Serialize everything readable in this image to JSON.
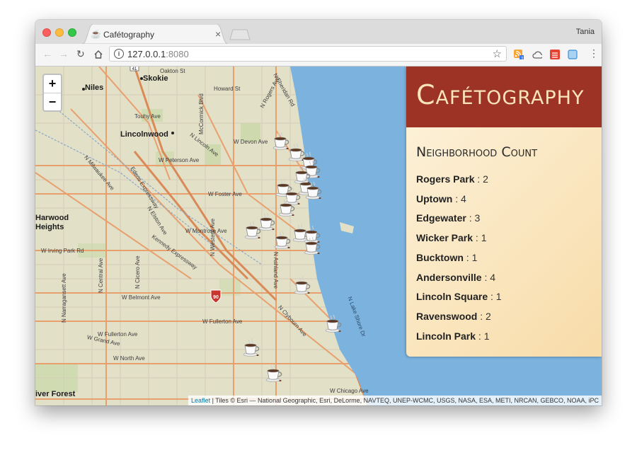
{
  "browser": {
    "tab_title": "Cafétography",
    "tab_icon": "coffee-cup-icon",
    "tab_close": "×",
    "user": "Tania",
    "url_host": "127.0.0.1",
    "url_port": ":8080"
  },
  "map": {
    "zoom_in": "+",
    "zoom_out": "−",
    "labels": {
      "niles": "Niles",
      "skokie": "Skokie",
      "lincolnwood": "Lincolnwood",
      "harwood": "Harwood",
      "heights": "Heights",
      "river_forest": "iver Forest",
      "oakton": "Oakton St",
      "howard": "Howard St",
      "touhy": "Touhy Ave",
      "devon": "W Devon Ave",
      "peterson": "W Peterson Ave",
      "foster": "W Foster Ave",
      "montrose": "W Montrose Ave",
      "irving": "W Irving Park Rd",
      "belmont": "W Belmont Ave",
      "fullerton": "W Fullerton Ave",
      "fullerton2": "W Fullerton Ave",
      "grand": "W Grand Ave",
      "north": "W North Ave",
      "chicago": "W Chicago Ave",
      "western": "N Western Ave",
      "cicero": "N Cicero Ave",
      "central": "N Central Ave",
      "narragansett": "N Narragansett Ave",
      "mccormick": "McCormick Blvd",
      "lincoln": "N Lincoln Ave",
      "elston": "N Elston Ave",
      "kennedy": "Kennedy Expressway",
      "edens": "Edens Expressway",
      "milwaukee": "N Milwaukee Ave",
      "clybourn": "N Clybourn Ave",
      "lakeshore": "N Lake Shore Dr",
      "rogers": "N Rogers Ave",
      "sheridan": "N Sheridan Rd",
      "ashland": "N Ashland Ave",
      "i90": "90",
      "i41": "41"
    },
    "attribution_link": "Leaflet",
    "attribution_text": " | Tiles © Esri — National Geographic, Esri, DeLorme, NAVTEQ, UNEP-WCMC, USGS, NASA, ESA, METI, NRCAN, GEBCO, NOAA, iPC",
    "marker_icon": "coffee-cup-icon",
    "colors": {
      "land": "#e3e0c8",
      "water": "#7bb3de",
      "road_major": "#e8a06e",
      "road_minor": "#d6d0c0",
      "park": "#c8d8a8"
    }
  },
  "panel": {
    "title": "Cafétography",
    "subtitle": "Neighborhood Count",
    "header_color": "#9c3324",
    "neighborhoods": [
      {
        "name": "Rogers Park",
        "count": 2
      },
      {
        "name": "Uptown",
        "count": 4
      },
      {
        "name": "Edgewater",
        "count": 3
      },
      {
        "name": "Wicker Park",
        "count": 1
      },
      {
        "name": "Bucktown",
        "count": 1
      },
      {
        "name": "Andersonville",
        "count": 4
      },
      {
        "name": "Lincoln Square",
        "count": 1
      },
      {
        "name": "Ravenswood",
        "count": 2
      },
      {
        "name": "Lincoln Park",
        "count": 1
      }
    ]
  }
}
